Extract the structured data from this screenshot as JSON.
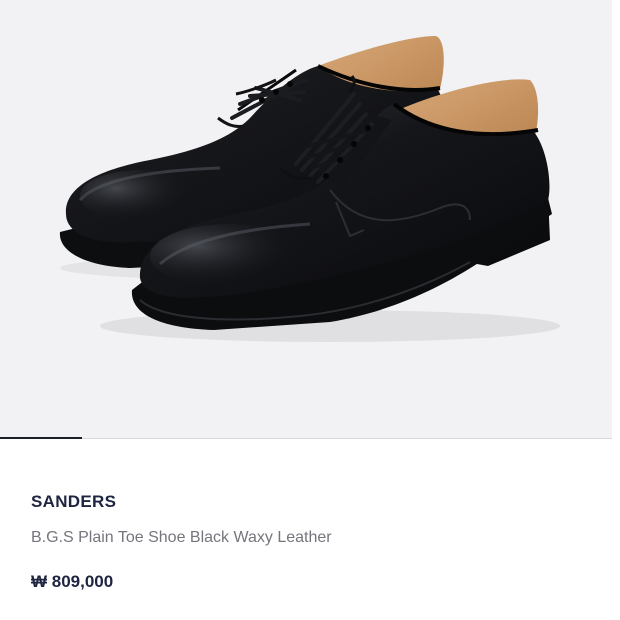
{
  "product": {
    "brand": "SANDERS",
    "name": "B.G.S Plain Toe Shoe Black Waxy Leather",
    "price": "₩ 809,000",
    "image_icon": "shoe-photo",
    "gallery_progress": 0.134
  },
  "colors": {
    "image_background": "#f2f2f4",
    "brand_text": "#1e2540",
    "name_text": "#75757d",
    "progress_fill": "#1c2028",
    "progress_track": "#d9d9de"
  }
}
